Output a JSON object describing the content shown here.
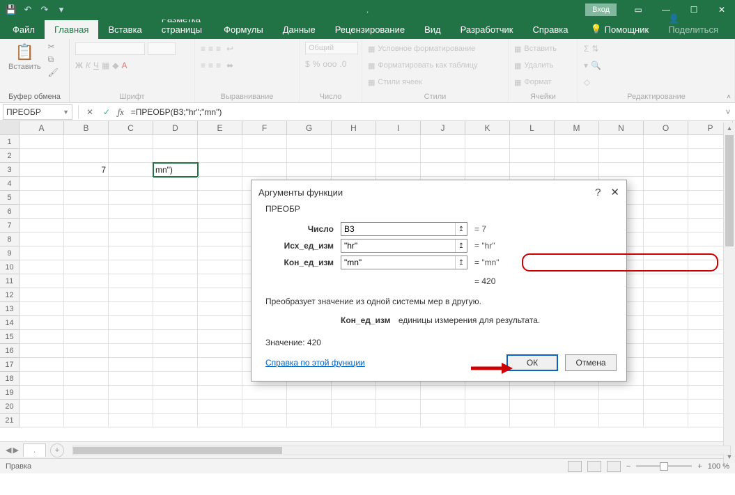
{
  "titlebar": {
    "login": "Вход"
  },
  "tabs": {
    "file": "Файл",
    "home": "Главная",
    "insert": "Вставка",
    "layout": "Разметка страницы",
    "formulas": "Формулы",
    "data": "Данные",
    "review": "Рецензирование",
    "view": "Вид",
    "developer": "Разработчик",
    "help": "Справка",
    "tellme": "Помощник",
    "share": "Поделиться"
  },
  "ribbon": {
    "clipboard": {
      "paste": "Вставить",
      "label": "Буфер обмена"
    },
    "font": {
      "label": "Шрифт",
      "bold": "Ж",
      "italic": "К",
      "underline": "Ч"
    },
    "align": {
      "label": "Выравнивание"
    },
    "number": {
      "label": "Число",
      "format": "Общий"
    },
    "styles": {
      "label": "Стили",
      "cond": "Условное форматирование",
      "table": "Форматировать как таблицу",
      "cell": "Стили ячеек"
    },
    "cells": {
      "label": "Ячейки",
      "insert": "Вставить",
      "delete": "Удалить",
      "format": "Формат"
    },
    "editing": {
      "label": "Редактирование"
    }
  },
  "namebox": "ПРЕОБР",
  "formula": "=ПРЕОБР(B3;\"hr\";\"mn\")",
  "columns": [
    "A",
    "B",
    "C",
    "D",
    "E",
    "F",
    "G",
    "H",
    "I",
    "J",
    "K",
    "L",
    "M",
    "N",
    "O",
    "P"
  ],
  "rowcount": 21,
  "cells": {
    "b3": "7",
    "d3": "mn\")"
  },
  "dialog": {
    "title": "Аргументы функции",
    "func": "ПРЕОБР",
    "arg1": {
      "label": "Число",
      "value": "B3",
      "eval": "7"
    },
    "arg2": {
      "label": "Исх_ед_изм",
      "value": "\"hr\"",
      "eval": "\"hr\""
    },
    "arg3": {
      "label": "Кон_ед_изм",
      "value": "\"mn\"",
      "eval": "\"mn\""
    },
    "result": "420",
    "desc_main": "Преобразует значение из одной системы мер в другую.",
    "desc_arg_name": "Кон_ед_изм",
    "desc_arg_text": "единицы измерения для результата.",
    "value_label": "Значение:",
    "help": "Справка по этой функции",
    "ok": "ОК",
    "cancel": "Отмена"
  },
  "status": {
    "mode": "Правка",
    "zoom": "100 %"
  },
  "sheet": {
    "name": "."
  }
}
